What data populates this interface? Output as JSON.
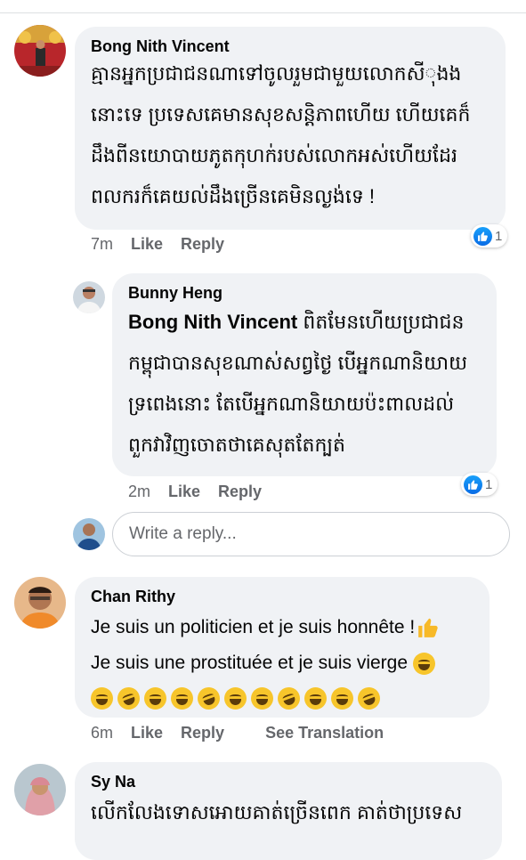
{
  "comments": [
    {
      "author": "Bong Nith Vincent",
      "lines": [
        "គ្មានអ្នកប្រជាជនណាទៅចូលរួមជាមួយលោកសីុងង",
        "នោះទេ ប្រទេសគេមានសុខសន្តិភាពហើយ ហើយគេក៏",
        "ដឹងពីនយោបាយភូតកុហក់របស់លោកអស់ហើយដែរ",
        "ពលករក៏គេយល់ដឹងច្រើនគេមិនល្ងង់ទេ !"
      ],
      "time": "7m",
      "like_label": "Like",
      "reply_label": "Reply",
      "reaction_count": "1"
    },
    {
      "author": "Bunny Heng",
      "mention": "Bong Nith Vincent",
      "first_line_rest": " ពិតមែនហើយប្រជាជន",
      "lines": [
        "កម្ពុជាបានសុខណាស់សព្វថ្ងៃ បើអ្នកណានិយាយ",
        "ទ្រពេងនោះ តែបើអ្នកណានិយាយប៉ះពាលដល់",
        "ពួកវាវិញចោតថាគេសុតតែក្បត់"
      ],
      "time": "2m",
      "like_label": "Like",
      "reply_label": "Reply",
      "reaction_count": "1"
    },
    {
      "author": "Chan Rithy",
      "lines": [
        "Je suis un politicien et je suis honnête !",
        "Je suis une prostituée et je suis vierge"
      ],
      "time": "6m",
      "like_label": "Like",
      "reply_label": "Reply",
      "translate_label": "See Translation"
    },
    {
      "author": "Sy Na",
      "lines": [
        "លើកលែងទោសអោយគាត់ច្រើនពេក គាត់ថាប្រទេស"
      ]
    }
  ],
  "reply_box": {
    "placeholder": "Write a reply..."
  },
  "colors": {
    "bubble": "#f0f2f5",
    "meta_text": "#65676b",
    "like_blue": "#1877f2"
  },
  "icons": [
    "like-reaction-icon",
    "thumbs-up-emoji",
    "laughing-emoji"
  ]
}
